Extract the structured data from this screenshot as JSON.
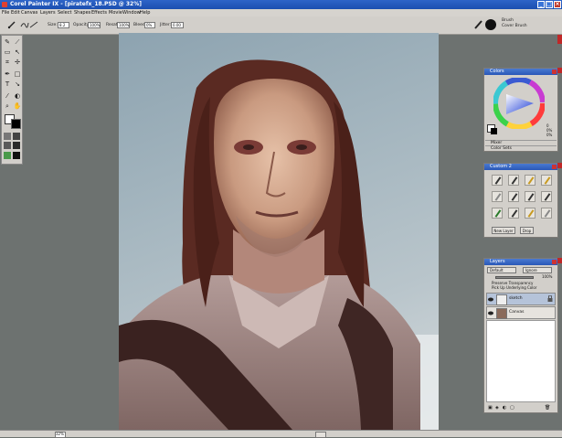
{
  "window": {
    "title": "Corel Painter IX - [piratefx_18.PSD @ 32%]"
  },
  "menu": [
    "File",
    "Edit",
    "Canvas",
    "Layers",
    "Select",
    "Shapes",
    "Effects",
    "Movie",
    "Window",
    "Help"
  ],
  "property_bar": {
    "size_label": "Size:",
    "size_value": "8.2",
    "opacity_label": "Opacity:",
    "opacity_value": "100%",
    "resat_label": "Resat:",
    "resat_value": "100%",
    "bleed_label": "Bleed:",
    "bleed_value": "0%",
    "jitter_label": "Jitter:",
    "jitter_value": "0.00"
  },
  "brush_selector": {
    "category": "Brush",
    "variant": "Cover Brush"
  },
  "colors_panel": {
    "title": "Colors",
    "hue_readout": "0",
    "sat_readout": "0%",
    "val_readout": "0%",
    "mixer_label": "Mixer",
    "color_sets_label": "Color Sets"
  },
  "custom_panel": {
    "title": "Custom 2",
    "new_layer_label": "New Layer",
    "drop_label": "Drop"
  },
  "layers_panel": {
    "title": "Layers",
    "composite_method": "Default",
    "composite_depth": "Ignore",
    "opacity_value": "100%",
    "preserve_transparency_label": "Preserve Transparency",
    "pick_up_label": "Pick Up Underlying Color",
    "layers": [
      {
        "name": "sketch"
      },
      {
        "name": "Canvas"
      }
    ]
  },
  "status_bar": {
    "zoom": "32%"
  },
  "colors": {
    "titlebar": "#1b4fb0",
    "panel_bg": "#d2cfca",
    "workspace_bg": "#6d7270"
  }
}
